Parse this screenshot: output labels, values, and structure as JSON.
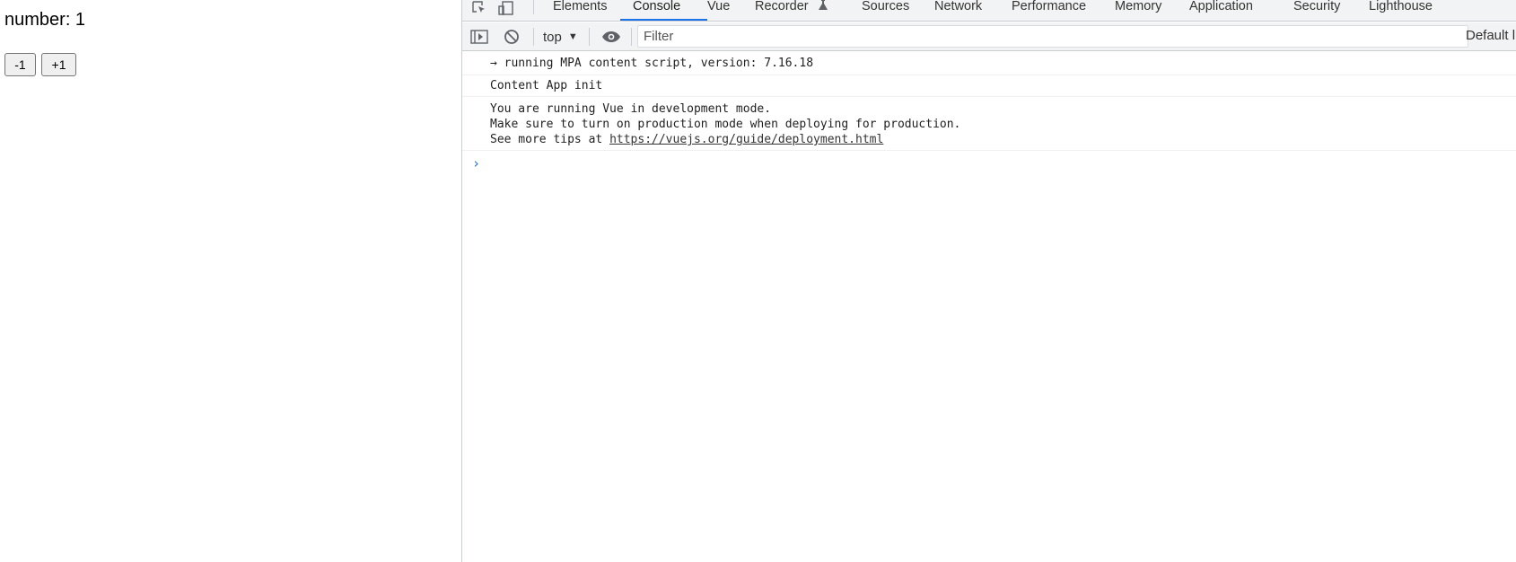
{
  "page": {
    "number_label": "number: 1",
    "decrement_label": "-1",
    "increment_label": "+1"
  },
  "devtools": {
    "tabs": [
      {
        "label": "Elements",
        "active": false
      },
      {
        "label": "Console",
        "active": true
      },
      {
        "label": "Vue",
        "active": false
      },
      {
        "label": "Recorder",
        "active": false
      },
      {
        "label": "Sources",
        "active": false
      },
      {
        "label": "Network",
        "active": false
      },
      {
        "label": "Performance",
        "active": false
      },
      {
        "label": "Memory",
        "active": false
      },
      {
        "label": "Application",
        "active": false
      },
      {
        "label": "Security",
        "active": false
      },
      {
        "label": "Lighthouse",
        "active": false
      }
    ],
    "toolbar": {
      "context": "top",
      "filter_placeholder": "Filter",
      "levels_label": "Default l"
    },
    "messages": [
      {
        "lines": [
          "→ running MPA content script, version: 7.16.18"
        ]
      },
      {
        "lines": [
          "Content App init"
        ]
      },
      {
        "lines": [
          "You are running Vue in development mode.",
          "Make sure to turn on production mode when deploying for production."
        ],
        "prefix": "See more tips at ",
        "link": "https://vuejs.org/guide/deployment.html"
      }
    ],
    "prompt_symbol": "›"
  },
  "colors": {
    "accent": "#1a73e8",
    "toolbar_bg": "#f1f3f4",
    "border": "#cbcdd1"
  }
}
